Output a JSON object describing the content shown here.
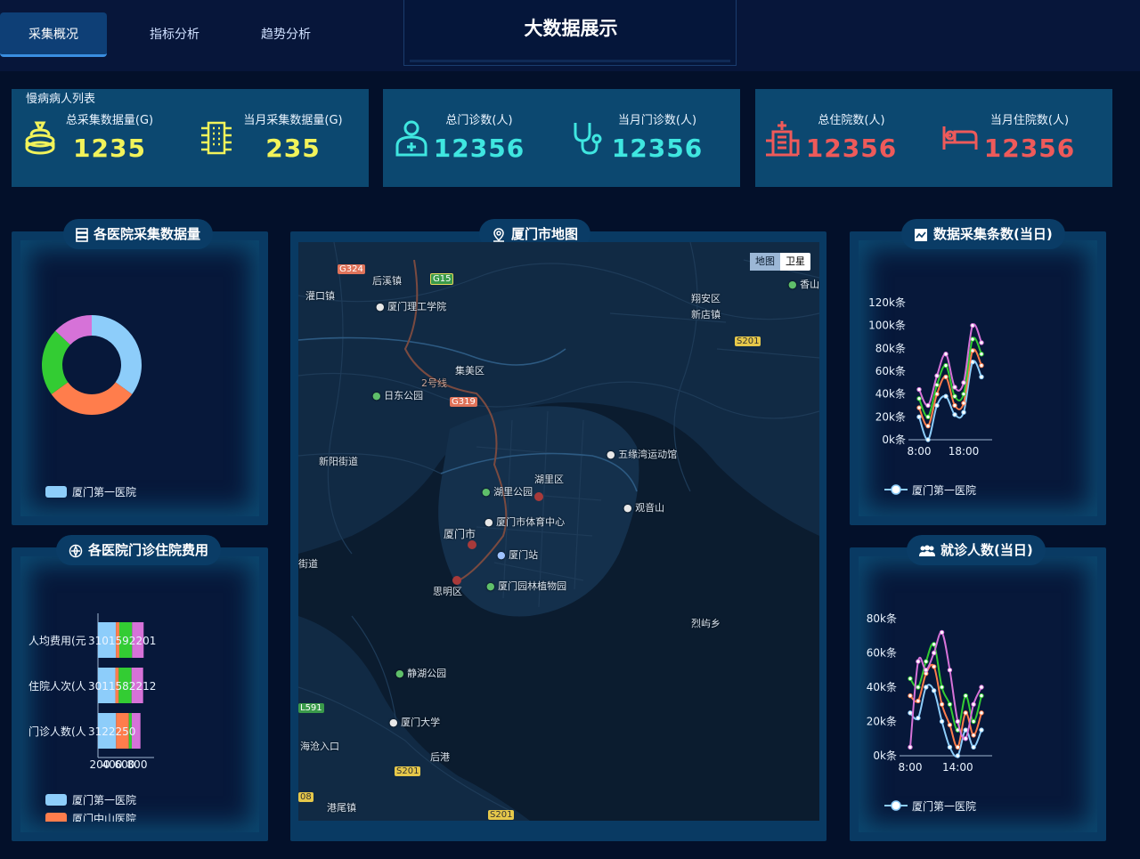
{
  "header": {
    "title": "大数据展示",
    "tabs": [
      {
        "label": "采集概况",
        "active": true
      },
      {
        "label": "指标分析",
        "active": false
      },
      {
        "label": "趋势分析",
        "active": false
      }
    ]
  },
  "stats": {
    "subtitle": "慢病病人列表",
    "total_collected": {
      "label": "总采集数据量(G)",
      "value": "1235"
    },
    "monthly_collected": {
      "label": "当月采集数据量(G)",
      "value": "235"
    },
    "total_outpatient": {
      "label": "总门诊数(人)",
      "value": "12356"
    },
    "monthly_outpatient": {
      "label": "当月门诊数(人)",
      "value": "12356"
    },
    "total_inpatient": {
      "label": "总住院数(人)",
      "value": "12356"
    },
    "monthly_inpatient": {
      "label": "当月住院数(人)",
      "value": "12356"
    }
  },
  "colors": {
    "yellow": "#f2f35a",
    "cyan": "#3fe6e0",
    "red": "#ee5a5a",
    "series1": "#8dcdfa",
    "series2": "#ff7d4c",
    "series3": "#33cc33",
    "series4": "#d672d8"
  },
  "panels": {
    "collection_by_hospital": {
      "title": "各医院采集数据量",
      "legend": [
        "厦门第一医院"
      ],
      "chart_data": {
        "type": "pie",
        "donut": true,
        "values": [
          35,
          30,
          22,
          13
        ]
      }
    },
    "cost_by_hospital": {
      "title": "各医院门诊住院费用",
      "legend": [
        "厦门第一医院",
        "厦门中山医院"
      ],
      "chart_data": {
        "type": "bar",
        "orientation": "horizontal",
        "stacked": true,
        "categories": [
          "人均费用(元)",
          "住院人次(人)",
          "门诊人数(人)"
        ],
        "category_labels_display": [
          "人均费用(元",
          "住院人次(人",
          "门诊人数(人"
        ],
        "xticks": [
          "200",
          "400",
          "600",
          "800"
        ],
        "overlapping_labels": [
          "3101592201",
          "3011582212",
          "3122250"
        ],
        "series": [
          {
            "values": [
              310,
              301,
              312
            ]
          },
          {
            "values": [
              59,
              58,
              222
            ]
          },
          {
            "values": [
              220,
              221,
              50
            ]
          },
          {
            "values": [
              200,
              200,
              150
            ]
          }
        ]
      }
    },
    "map": {
      "title": "厦门市地图",
      "toggle": [
        "地图",
        "卫星"
      ],
      "labels": {
        "tongan": "翔安区",
        "xindian": "新店镇",
        "jimei": "集美区",
        "huli": "湖里区",
        "siming": "思明区",
        "xiamen": "厦门市",
        "xinyang": "新阳街道",
        "houxi": "后溪镇",
        "guankou": "灌口镇",
        "lieyu": "烈屿乡",
        "haicang": "海沧入口",
        "gangwei": "港尾镇",
        "jiedao": "街道",
        "hougang": "后港",
        "xiangshan": "香山",
        "ligong": "厦门理工学院",
        "ridong": "日东公园",
        "wuyuanwan": "五缘湾运动馆",
        "guanyinshan": "观音山",
        "hulipark": "湖里公园",
        "tiyu": "厦门市体育中心",
        "station": "厦门站",
        "yuanlin": "厦门园林植物园",
        "jinghu": "静湖公园",
        "xmu": "厦门大学",
        "line2": "2号线"
      },
      "shields": {
        "g324": "G324",
        "g15": "G15",
        "g319": "G319",
        "s201a": "S201",
        "s201b": "S201",
        "s201c": "S201",
        "l591": "L591",
        "n08": "08"
      }
    },
    "collection_count": {
      "title": "数据采集条数(当日)",
      "legend": [
        "厦门第一医院"
      ],
      "chart_data": {
        "type": "line",
        "smooth": true,
        "x": [
          "8:00",
          "10:00",
          "12:00",
          "14:00",
          "16:00",
          "18:00",
          "20:00",
          "22:00"
        ],
        "xticks_shown": [
          "8:00",
          "18:00"
        ],
        "yticks": [
          "0k条",
          "20k条",
          "40k条",
          "60k条",
          "80k条",
          "100k条",
          "120k条"
        ],
        "ylim": [
          0,
          120
        ],
        "series": [
          {
            "values": [
              20,
              0,
              30,
              38,
              22,
              24,
              68,
              55
            ]
          },
          {
            "values": [
              28,
              12,
              40,
              55,
              30,
              32,
              78,
              65
            ]
          },
          {
            "values": [
              36,
              20,
              48,
              65,
              38,
              40,
              88,
              75
            ]
          },
          {
            "values": [
              44,
              30,
              56,
              75,
              46,
              50,
              100,
              85
            ]
          }
        ]
      }
    },
    "visit_count": {
      "title": "就诊人数(当日)",
      "legend": [
        "厦门第一医院"
      ],
      "chart_data": {
        "type": "line",
        "smooth": true,
        "x": [
          "8:00",
          "9:00",
          "10:00",
          "11:00",
          "12:00",
          "13:00",
          "14:00",
          "15:00",
          "16:00",
          "17:00"
        ],
        "xticks_shown": [
          "8:00",
          "14:00"
        ],
        "yticks": [
          "0k条",
          "20k条",
          "40k条",
          "60k条",
          "80k条"
        ],
        "ylim": [
          0,
          80
        ],
        "series": [
          {
            "values": [
              25,
              22,
              40,
              38,
              20,
              5,
              0,
              15,
              5,
              15
            ]
          },
          {
            "values": [
              35,
              32,
              48,
              52,
              30,
              18,
              5,
              25,
              12,
              25
            ]
          },
          {
            "values": [
              45,
              40,
              55,
              65,
              40,
              30,
              15,
              35,
              20,
              35
            ]
          },
          {
            "values": [
              5,
              55,
              50,
              60,
              72,
              50,
              20,
              10,
              30,
              40
            ]
          }
        ]
      }
    }
  }
}
